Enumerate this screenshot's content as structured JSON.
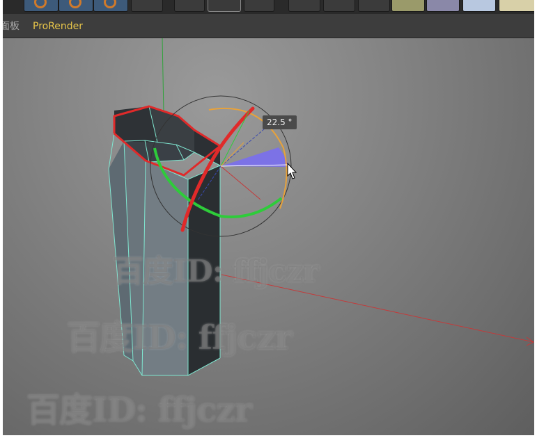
{
  "menubar": {
    "items": [
      {
        "label": "面板",
        "color": "#a8a8a8"
      },
      {
        "label": "ProRender",
        "color": "#e8c64a"
      }
    ]
  },
  "viewport": {
    "rotation_label": "22.5 °",
    "colors": {
      "axis_x": "#c43a3a",
      "axis_y": "#2fa33a",
      "rotate_x_ring": "#e02a2a",
      "rotate_y_ring": "#2ecc3a",
      "rotate_z_ring": "#e8a23a",
      "selection_edge": "#e02a2a",
      "mesh_edge": "#7fe6d0",
      "sweep_fill": "#7a6ff0"
    }
  },
  "watermarks": [
    "百度ID: ffjczr",
    "百度ID: ffjczr",
    "百度ID: ffjczr"
  ]
}
